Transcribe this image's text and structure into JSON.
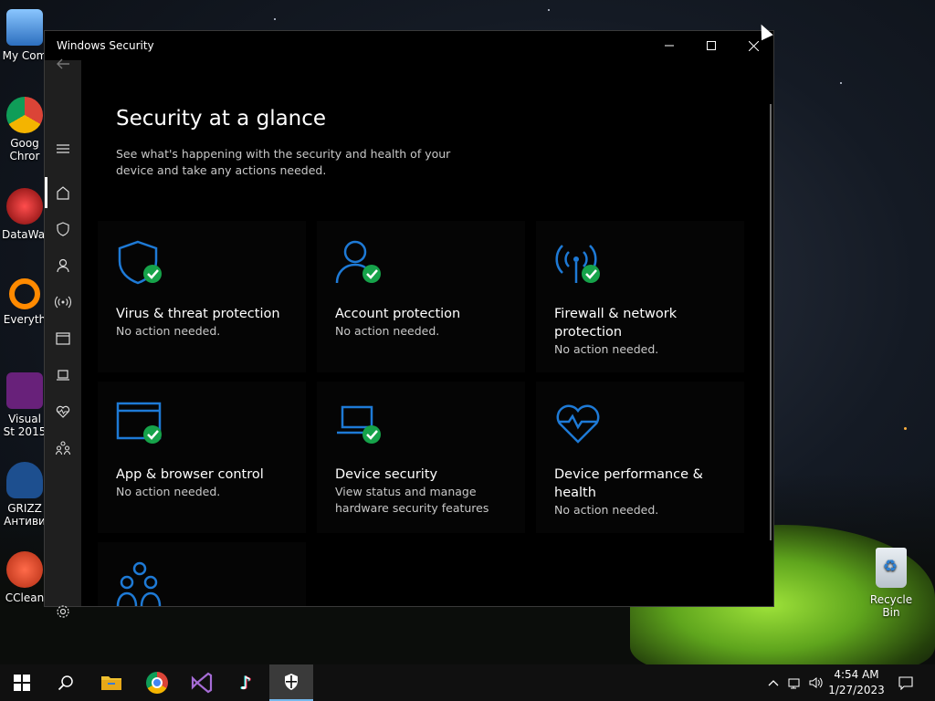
{
  "window": {
    "title": "Windows Security",
    "controls": {
      "minimize": "─",
      "maximize": "☐",
      "close": "✕"
    }
  },
  "nav": {
    "back_icon": "back-arrow-icon",
    "items": [
      {
        "name": "menu",
        "icon": "hamburger-icon"
      },
      {
        "name": "home",
        "icon": "home-icon",
        "active": true
      },
      {
        "name": "virus",
        "icon": "shield-icon"
      },
      {
        "name": "account",
        "icon": "person-icon"
      },
      {
        "name": "firewall",
        "icon": "antenna-icon"
      },
      {
        "name": "app-browser",
        "icon": "window-icon"
      },
      {
        "name": "device-security",
        "icon": "laptop-icon"
      },
      {
        "name": "device-performance",
        "icon": "heart-icon"
      },
      {
        "name": "family",
        "icon": "family-icon"
      },
      {
        "name": "settings",
        "icon": "gear-icon"
      }
    ]
  },
  "main": {
    "title": "Security at a glance",
    "subtitle": "See what's happening with the security and health of your device and take any actions needed."
  },
  "tiles": [
    {
      "title": "Virus & threat protection",
      "status": "No action needed.",
      "icon": "shield-icon",
      "check": true
    },
    {
      "title": "Account protection",
      "status": "No action needed.",
      "icon": "person-icon",
      "check": true
    },
    {
      "title": "Firewall & network protection",
      "status": "No action needed.",
      "icon": "antenna-icon",
      "check": true
    },
    {
      "title": "App & browser control",
      "status": "No action needed.",
      "icon": "window-icon",
      "check": true
    },
    {
      "title": "Device security",
      "status": "View status and manage hardware security features",
      "icon": "laptop-icon",
      "check": true
    },
    {
      "title": "Device performance & health",
      "status": "No action needed.",
      "icon": "heart-icon",
      "check": false
    },
    {
      "title": "",
      "status": "",
      "icon": "family-icon",
      "check": false
    }
  ],
  "desktop": {
    "icons": [
      {
        "label": "My Com",
        "icon": "computer-icon"
      },
      {
        "label": "Goog Chror",
        "icon": "chrome-icon"
      },
      {
        "label": "DataWag",
        "icon": "datawag-icon"
      },
      {
        "label": "Everyth",
        "icon": "search-everything-icon"
      },
      {
        "label": "Visual St 2015",
        "icon": "visual-studio-icon"
      },
      {
        "label": "GRIZZ Антиви",
        "icon": "grizzly-icon"
      },
      {
        "label": "CClean",
        "icon": "ccleaner-icon"
      }
    ],
    "recycle_bin": "Recycle Bin"
  },
  "taskbar": {
    "items": [
      {
        "name": "start",
        "icon": "windows-logo-icon"
      },
      {
        "name": "search",
        "icon": "search-icon"
      },
      {
        "name": "file-explorer",
        "icon": "folder-icon"
      },
      {
        "name": "chrome",
        "icon": "chrome-icon"
      },
      {
        "name": "visual-studio",
        "icon": "visual-studio-icon"
      },
      {
        "name": "tiktok",
        "icon": "tiktok-icon"
      },
      {
        "name": "windows-security",
        "icon": "shield-icon",
        "active": true
      }
    ],
    "clock": {
      "time": "4:54 AM",
      "date": "1/27/2023"
    }
  },
  "colors": {
    "accent": "#1e7ad6",
    "check": "#16a34a",
    "window_bg": "#000000",
    "nav_bg": "#1f1f1f"
  }
}
